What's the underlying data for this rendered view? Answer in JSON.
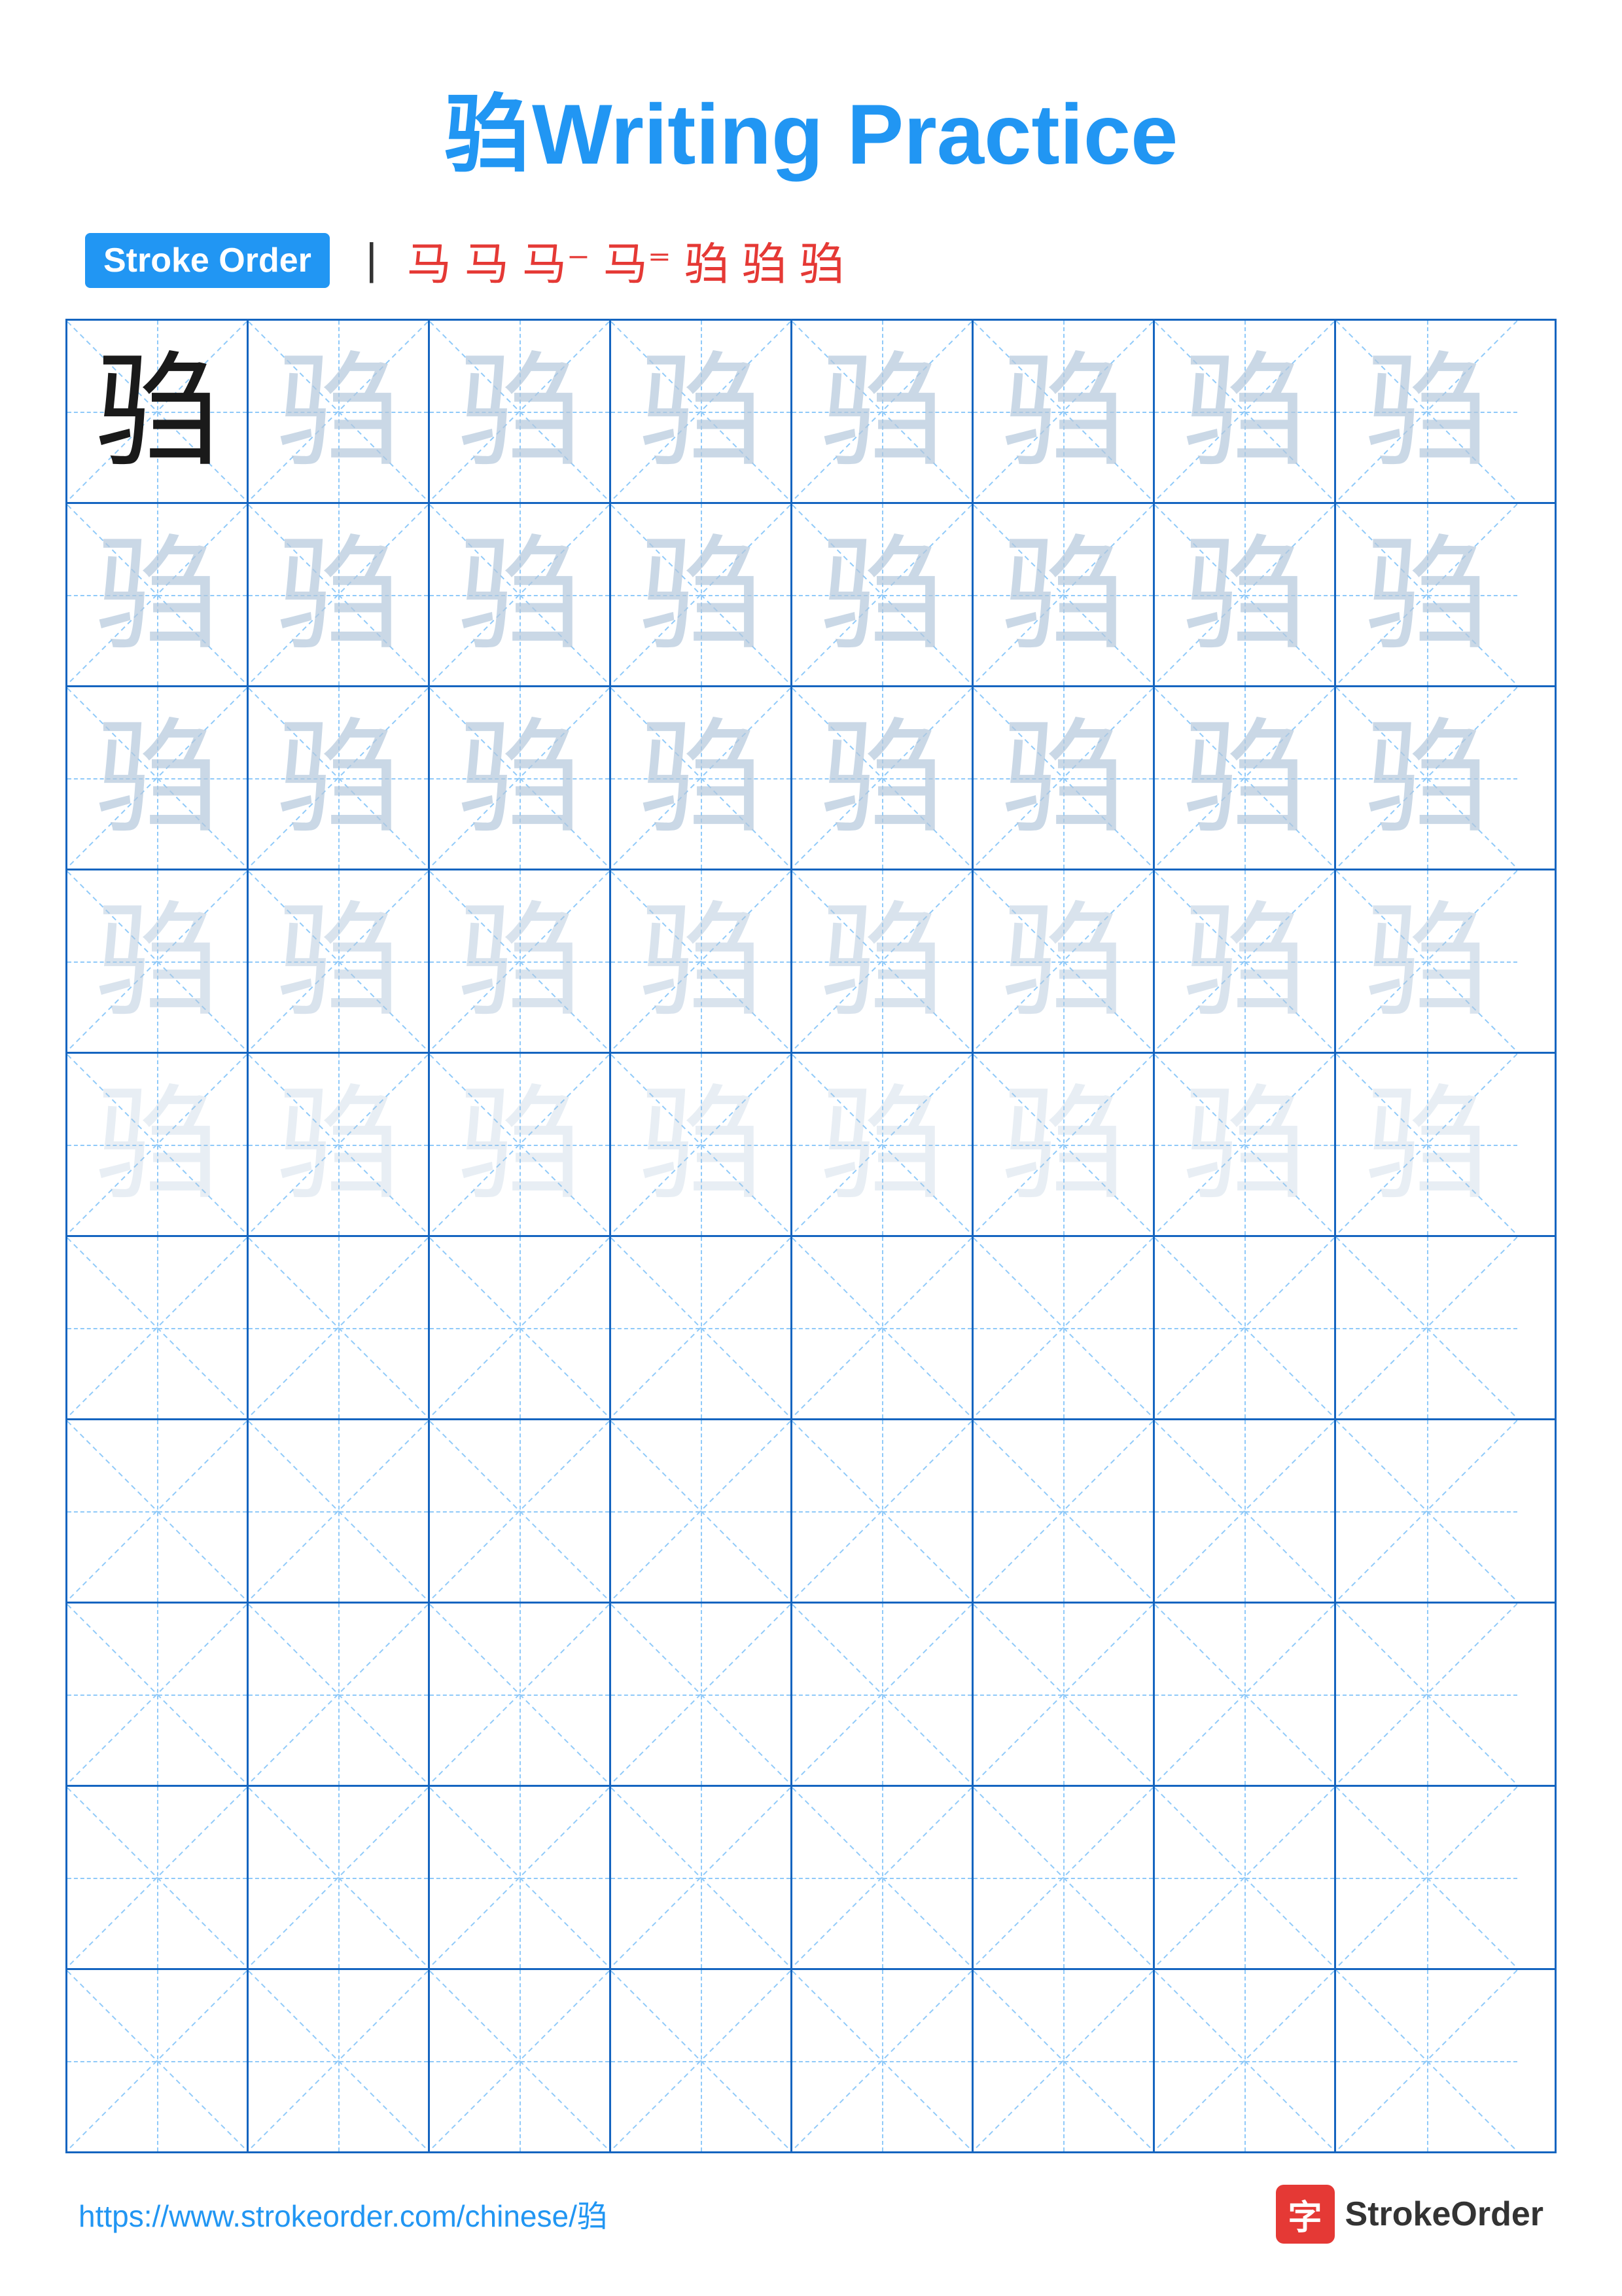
{
  "title": {
    "char": "驺",
    "text": " Writing Practice"
  },
  "stroke_order": {
    "badge_label": "Stroke Order",
    "strokes": [
      "丨",
      "马",
      "马",
      "马'",
      "马'",
      "驺",
      "驺",
      "驺"
    ]
  },
  "grid": {
    "rows": 10,
    "cols": 8,
    "char": "驺",
    "filled_rows": 5,
    "empty_rows": 5
  },
  "footer": {
    "url": "https://www.strokeorder.com/chinese/驺",
    "brand_char": "字",
    "brand_name": "StrokeOrder"
  }
}
